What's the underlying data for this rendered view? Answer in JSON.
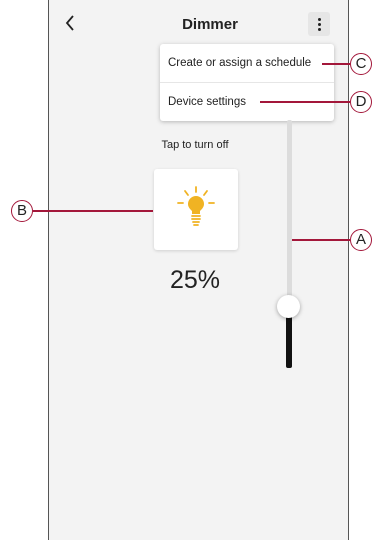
{
  "header": {
    "title": "Dimmer"
  },
  "menu": {
    "items": [
      "Create or assign a schedule",
      "Device settings"
    ]
  },
  "device": {
    "hint": "Tap to turn off",
    "brightness_label": "25%",
    "brightness_level": 25
  },
  "callouts": {
    "a": "A",
    "b": "B",
    "c": "C",
    "d": "D"
  },
  "colors": {
    "callout": "#a3173a",
    "bulb": "#f0b323"
  },
  "icons": {
    "back": "chevron-left-icon",
    "more": "kebab-menu-icon",
    "bulb": "lightbulb-icon"
  }
}
